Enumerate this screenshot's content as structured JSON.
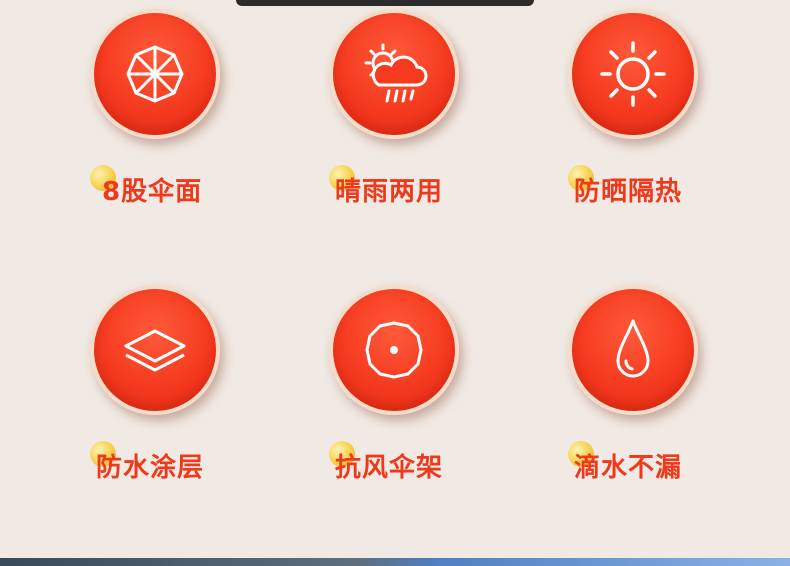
{
  "features": [
    {
      "id": "ribs",
      "label": "8股伞面",
      "icon": "umbrella-ribs-icon"
    },
    {
      "id": "sun-rain",
      "label": "晴雨两用",
      "icon": "sun-cloud-rain-icon"
    },
    {
      "id": "sun-protect",
      "label": "防晒隔热",
      "icon": "sun-icon"
    },
    {
      "id": "coating",
      "label": "防水涂层",
      "icon": "layers-icon"
    },
    {
      "id": "frame",
      "label": "抗风伞架",
      "icon": "umbrella-frame-icon"
    },
    {
      "id": "drip",
      "label": "滴水不漏",
      "icon": "water-drop-icon"
    }
  ],
  "colors": {
    "accent": "#ee3a1c",
    "circle": "#f53a1f",
    "background": "#f1e9e3",
    "dot": "#f6cf4b"
  }
}
